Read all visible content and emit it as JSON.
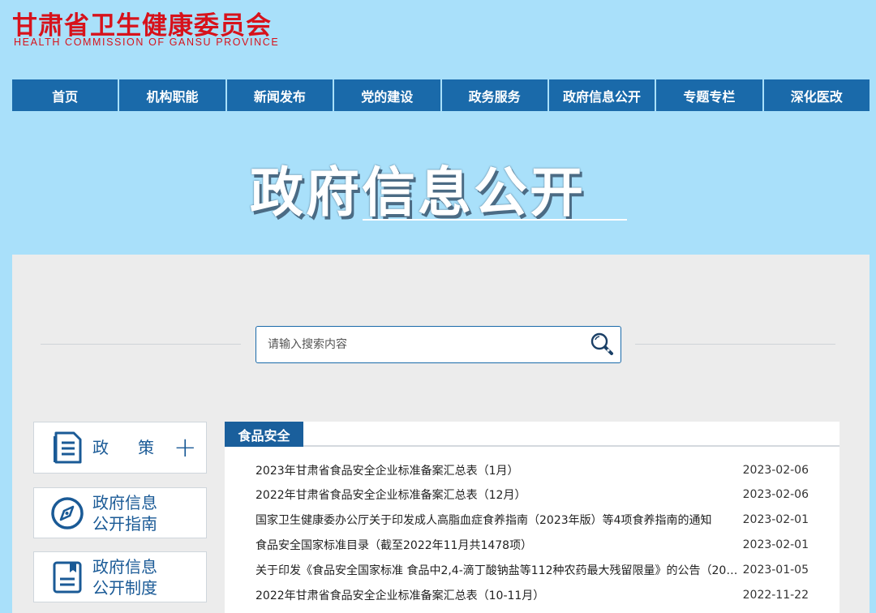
{
  "header": {
    "logo_cn": "甘肃省卫生健康委员会",
    "logo_en": "HEALTH COMMISSION OF GANSU PROVINCE"
  },
  "nav": [
    "首页",
    "机构职能",
    "新闻发布",
    "党的建设",
    "政务服务",
    "政府信息公开",
    "专题专栏",
    "深化医改"
  ],
  "hero": {
    "title": "政府信息公开"
  },
  "search": {
    "placeholder": "请输入搜索内容"
  },
  "sidebar": [
    {
      "label": "政策",
      "icon": "document-list-icon",
      "action": "plus-icon"
    },
    {
      "line1": "政府信息",
      "line2": "公开指南",
      "icon": "compass-icon"
    },
    {
      "line1": "政府信息",
      "line2": "公开制度",
      "icon": "notebook-icon"
    }
  ],
  "news": {
    "tab": "食品安全",
    "items": [
      {
        "title": "2023年甘肃省食品安全企业标准备案汇总表（1月）",
        "date": "2023-02-06"
      },
      {
        "title": "2022年甘肃省食品安全企业标准备案汇总表（12月）",
        "date": "2023-02-06"
      },
      {
        "title": "国家卫生健康委办公厅关于印发成人高脂血症食养指南（2023年版）等4项食养指南的通知",
        "date": "2023-02-01"
      },
      {
        "title": "食品安全国家标准目录（截至2022年11月共1478项）",
        "date": "2023-02-01"
      },
      {
        "title": "关于印发《食品安全国家标准 食品中2,4-滴丁酸钠盐等112种农药最大残留限量》的公告（202...",
        "date": "2023-01-05"
      },
      {
        "title": "2022年甘肃省食品安全企业标准备案汇总表（10-11月）",
        "date": "2022-11-22"
      }
    ]
  },
  "colors": {
    "nav_bg": "#1a6aaa",
    "logo_red": "#d7121b",
    "page_bg": "#a9e0fa"
  }
}
